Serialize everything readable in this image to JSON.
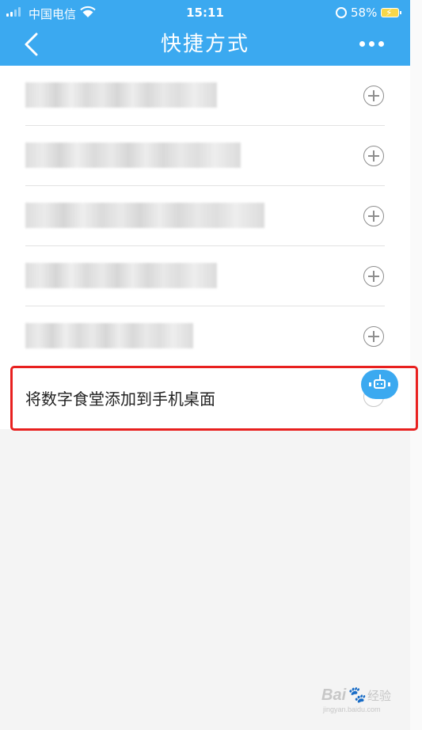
{
  "status_bar": {
    "carrier": "中国电信",
    "time": "15:11",
    "battery_percent": "58%"
  },
  "header": {
    "title": "快捷方式",
    "bg_color": "#3ba9f0"
  },
  "list": {
    "items": [
      {
        "label": "",
        "blurred": true
      },
      {
        "label": "",
        "blurred": true
      },
      {
        "label": "",
        "blurred": true
      },
      {
        "label": "",
        "blurred": true
      },
      {
        "label": "",
        "blurred": true
      }
    ],
    "highlighted_item": {
      "label": "将数字食堂添加到手机桌面"
    }
  },
  "highlight_color": "#e8201f",
  "watermark": {
    "logo": "Bai",
    "suffix": "经验",
    "sub": "jingyan.baidu.com"
  }
}
